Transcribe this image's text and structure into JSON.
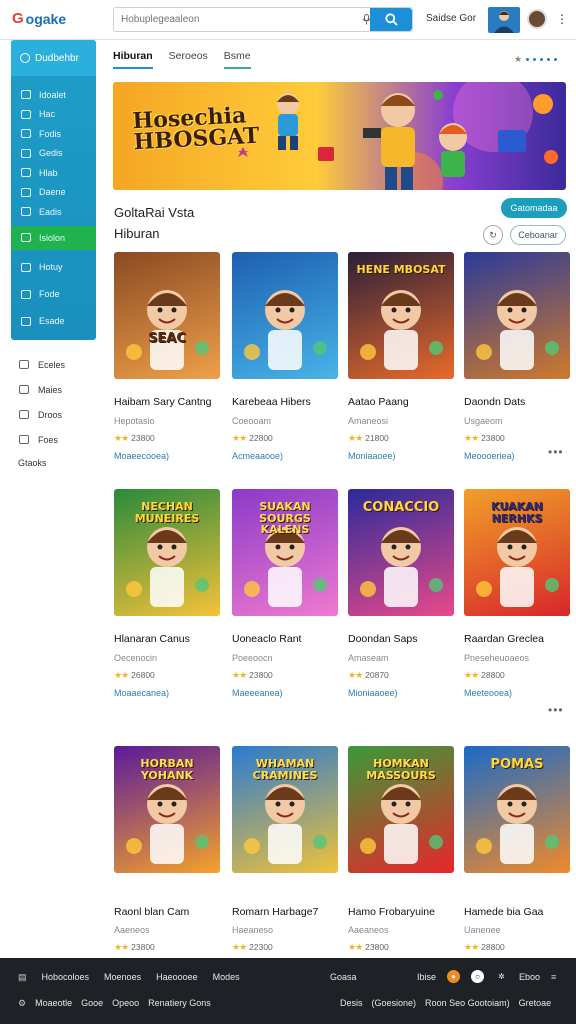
{
  "header": {
    "logo_text": "ogake",
    "logo_letter": "G",
    "search_placeholder": "Hobuplegeaaleon",
    "sign_in": "Saidse Gor"
  },
  "sidebar": {
    "head_label": "Dudbehbr",
    "items": [
      "Idoalet",
      "Hac",
      "Fodis",
      "Gedis",
      "Hlab",
      "Daene",
      "Eadis"
    ],
    "active_item": "Isiolon",
    "items2": [
      "Hotuy",
      "Fode",
      "Esade"
    ],
    "lower_items": [
      "Eceles",
      "Maies",
      "Droos",
      "Foes"
    ],
    "lower_plain": "Gtaoks"
  },
  "tabs": [
    "Hiburan",
    "Seroeos",
    "Bsme"
  ],
  "banner": {
    "title_line1": "Hosechia",
    "title_line2": "HBOSGAT"
  },
  "section": {
    "title": "GoltaRai Vsta",
    "subtitle": "Hiburan",
    "primary_button": "Gatomadaa",
    "outline_button": "Ceboanar"
  },
  "cards": [
    {
      "title": "Haibam Sary Cantng",
      "sub": "Hepotasio",
      "rating": "23800",
      "link": "Moaeecooea)",
      "art": "SEAC"
    },
    {
      "title": "Karebeaa Hibers",
      "sub": "Coeooam",
      "rating": "22800",
      "link": "Acmeaaooe)",
      "art": ""
    },
    {
      "title": "Aatao Paang",
      "sub": "Amaneosi",
      "rating": "21800",
      "link": "Moniaaoee)",
      "art": "HENE MBOSAT"
    },
    {
      "title": "Daondn Dats",
      "sub": "Usgaeom",
      "rating": "23800",
      "link": "Meoooeriea)",
      "art": ""
    },
    {
      "title": "Hlanaran Canus",
      "sub": "Oecenocin",
      "rating": "26800",
      "link": "Moaaecanea)",
      "art": "NECHAN MUNEIRES"
    },
    {
      "title": "Uoneaclo Rant",
      "sub": "Poeeoocn",
      "rating": "23800",
      "link": "Maeeeanea)",
      "art": "SUAKAN SOURGS KALENS"
    },
    {
      "title": "Doondan Saps",
      "sub": "Amaseam",
      "rating": "20870",
      "link": "Mioniaaoee)",
      "art": "CONACCIO"
    },
    {
      "title": "Raardan Greclea",
      "sub": "Pneseheuoaeos",
      "rating": "28800",
      "link": "Meeteooea)",
      "art": "KUAKAN NERHKS"
    },
    {
      "title": "Raonl blan Cam",
      "sub": "Aaeneos",
      "rating": "23800",
      "link": "",
      "art": "HORBAN YOHANK"
    },
    {
      "title": "Romarn Harbage7",
      "sub": "Haeaneso",
      "rating": "22300",
      "link": "",
      "art": "WHAMAN CRAMINES"
    },
    {
      "title": "Hamo Frobaryuine",
      "sub": "Aaeaneos",
      "rating": "23800",
      "link": "",
      "art": "HOMKAN MASSOURS"
    },
    {
      "title": "Hamede bia Gaa",
      "sub": "Uanenee",
      "rating": "28800",
      "link": "",
      "art": "POMAS"
    }
  ],
  "footer": {
    "row1_left": [
      "Hobocoloes",
      "Moenoes",
      "Haeoooee",
      "Modes"
    ],
    "row1_mid": "Goasa",
    "row1_right": [
      "Ibise",
      "Eboo"
    ],
    "row2_left": [
      "Moaeotle",
      "Gooe",
      "Opeoo",
      "Renatiery Gons"
    ],
    "row2_right": [
      "Desis",
      "(Goesione)",
      "Roon Seo Gootoiam)",
      "Gretoae"
    ]
  },
  "colors": {
    "accent": "#1c8fd8",
    "sidebar": "#1f9ec9",
    "active": "#20b24f",
    "footer": "#1e2226",
    "star": "#f0b429"
  }
}
